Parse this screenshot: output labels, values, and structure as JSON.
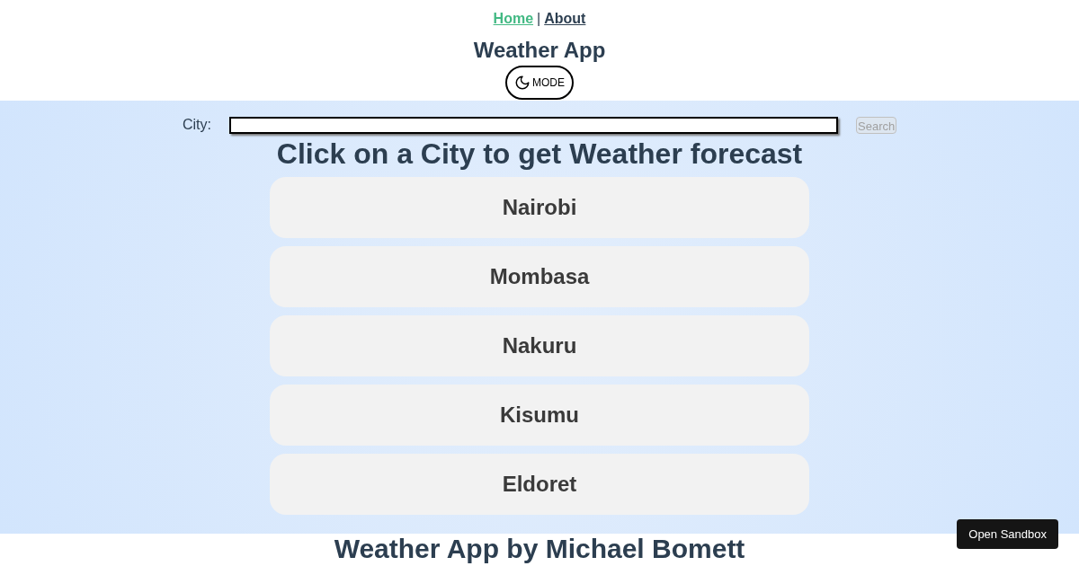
{
  "nav": [
    {
      "label": "Home",
      "selected": true
    },
    {
      "label": "About",
      "selected": false
    }
  ],
  "nav_separator": "|",
  "title": "Weather App",
  "mode_button": {
    "label": "MODE"
  },
  "search": {
    "label": "City:",
    "button": "Search",
    "button_disabled": true
  },
  "heading": "Click on a City to get Weather forecast",
  "cities": [
    "Nairobi",
    "Mombasa",
    "Nakuru",
    "Kisumu",
    "Eldoret"
  ],
  "footer": "Weather App by Michael Bomett",
  "sandbox_button": "Open Sandbox"
}
